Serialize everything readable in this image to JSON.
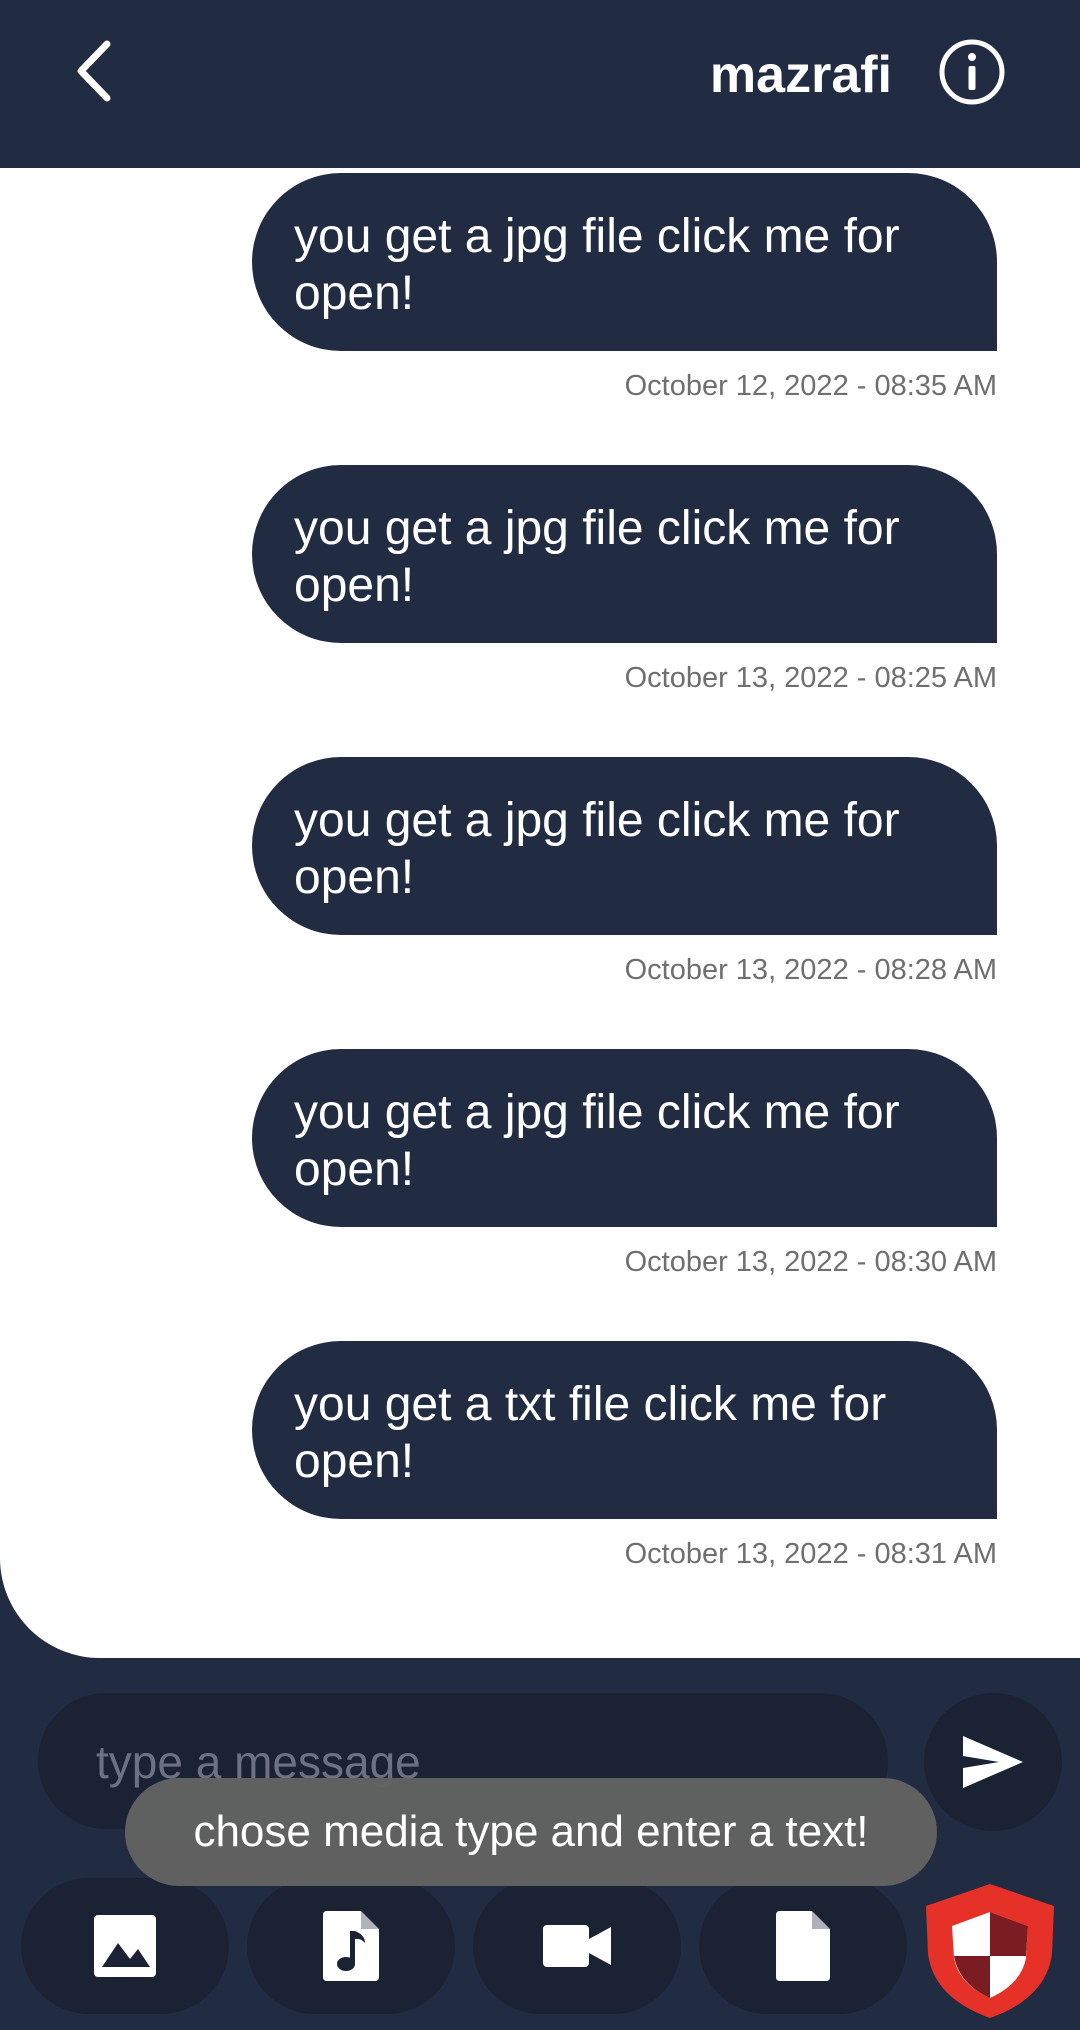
{
  "header": {
    "title": "mazrafi",
    "back_icon": "chevron-left-icon",
    "info_icon": "info-icon"
  },
  "messages": [
    {
      "text": "you get a jpg file click me for open!",
      "time": "October 12, 2022 - 08:35 AM"
    },
    {
      "text": "you get a jpg file click me for open!",
      "time": "October 13, 2022 - 08:25 AM"
    },
    {
      "text": "you get a jpg file click me for open!",
      "time": "October 13, 2022 - 08:28 AM"
    },
    {
      "text": "you get a jpg file click me for open!",
      "time": "October 13, 2022 - 08:30 AM"
    },
    {
      "text": "you get a txt file click me for open!",
      "time": "October 13, 2022 - 08:31 AM"
    }
  ],
  "composer": {
    "placeholder": "type a message",
    "send_icon": "send-icon"
  },
  "media_buttons": [
    {
      "icon": "image-icon"
    },
    {
      "icon": "music-file-icon"
    },
    {
      "icon": "video-camera-icon"
    },
    {
      "icon": "document-icon"
    }
  ],
  "security_badge_icon": "shield-icon",
  "toast": {
    "text": "chose media type and enter a text!"
  },
  "colors": {
    "primary": "#212c42",
    "bubble_text": "#ffffff",
    "timestamp": "#6f6f6f",
    "input_bg": "#1a2233",
    "shield_red": "#e53127",
    "shield_dark": "#7b1b22"
  }
}
